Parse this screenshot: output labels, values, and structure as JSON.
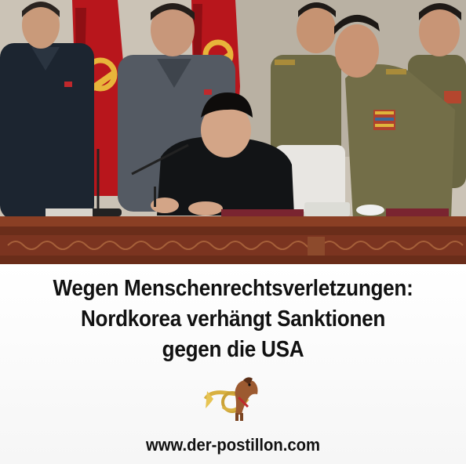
{
  "headline": {
    "line1": "Wegen Menschenrechtsverletzungen:",
    "line2": "Nordkorea verhängt Sanktionen",
    "line3": "gegen die USA"
  },
  "logo": {
    "icon": "posthorn-horse-logo-icon"
  },
  "footer": {
    "url": "www.der-postillon.com"
  },
  "colors": {
    "flag_red": "#b8161c",
    "emblem_gold": "#e8b53a",
    "desk_wood": "#6a2d1a",
    "uniform_olive": "#6e6a45",
    "text": "#111111"
  }
}
